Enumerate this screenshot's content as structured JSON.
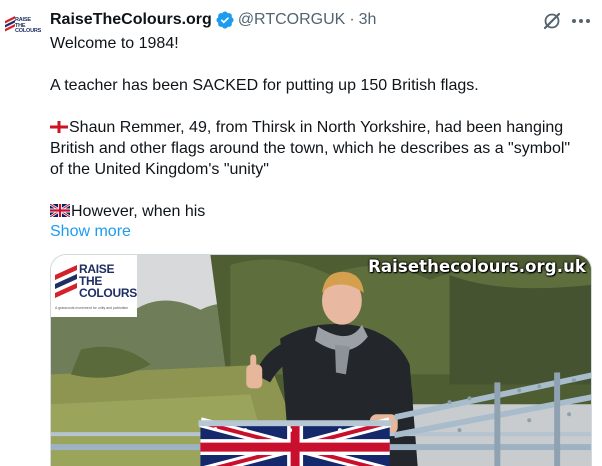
{
  "tweet": {
    "author": {
      "display_name": "RaiseTheColours.org",
      "handle": "@RTCORGUK",
      "avatar_lines": [
        "RAISE",
        "THE",
        "COLOURS"
      ],
      "verified_icon": "verified-badge-icon"
    },
    "separator": "·",
    "time": "3h",
    "lines": {
      "l1": "Welcome to 1984!",
      "l2": "A teacher has been SACKED for putting up 150 British flags.",
      "l3": "Shaun Remmer, 49, from Thirsk in North Yorkshire, had been hanging",
      "l4": "British and other flags around the town, which he describes as a \"symbol\"",
      "l5": "of the United Kingdom's \"unity\"",
      "l6": "However, when his"
    },
    "show_more": "Show more",
    "icons": {
      "grok": "grok-icon",
      "more": "more-options-icon",
      "eng_flag": "england-flag-emoji",
      "uk_flag": "uk-flag-emoji"
    }
  },
  "media": {
    "logo_lines": [
      "RAISE",
      "THE",
      "COLOURS"
    ],
    "logo_tagline": "A grassroots movement for unity and patriotism",
    "watermark": "Raisethecolours.org.uk"
  },
  "colors": {
    "link": "#1d9bf0",
    "secondary": "#536471",
    "verified": "#1d9bf0",
    "brand_navy": "#1f2e63",
    "brand_red": "#d2232a"
  }
}
